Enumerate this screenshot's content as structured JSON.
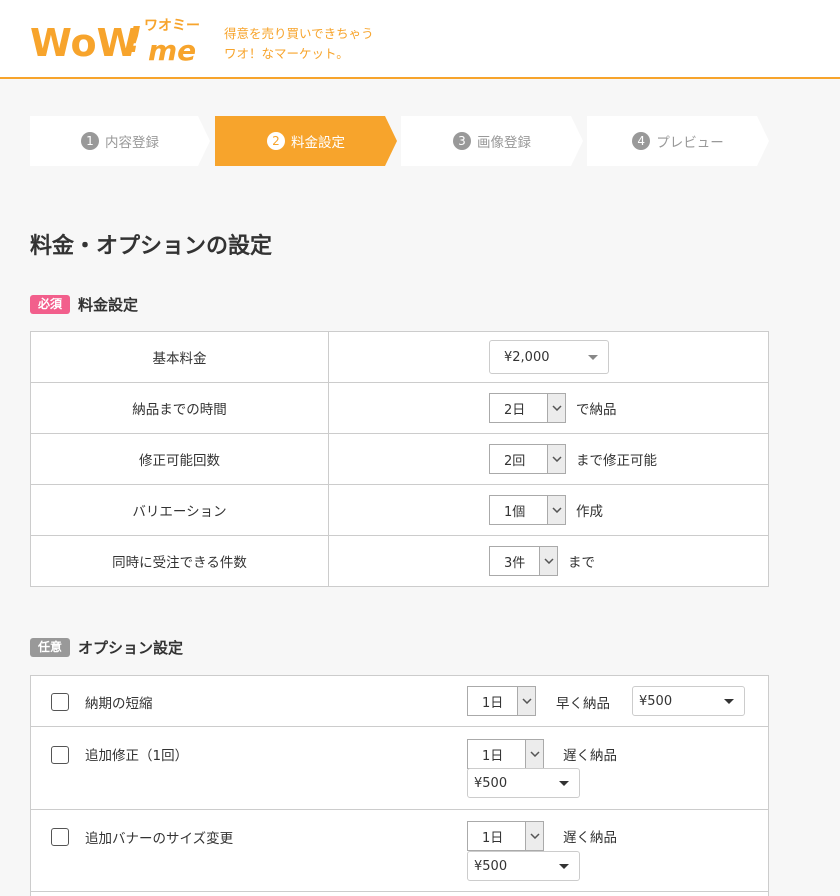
{
  "brand": {
    "logo_text": "WoW!me",
    "logo_kana": "ワオミー",
    "tagline_line1": "得意を売り買いできちゃう",
    "tagline_line2": "ワオ！なマーケット。",
    "accent_color": "#f7a42c"
  },
  "steps": [
    {
      "num": "1",
      "label": "内容登録",
      "active": false
    },
    {
      "num": "2",
      "label": "料金設定",
      "active": true
    },
    {
      "num": "3",
      "label": "画像登録",
      "active": false
    },
    {
      "num": "4",
      "label": "プレビュー",
      "active": false
    }
  ],
  "page_title": "料金・オプションの設定",
  "pricing": {
    "badge": "必須",
    "heading": "料金設定",
    "rows": [
      {
        "label": "基本料金",
        "value": "¥2,000",
        "suffix": ""
      },
      {
        "label": "納品までの時間",
        "value": "2日",
        "suffix": "で納品"
      },
      {
        "label": "修正可能回数",
        "value": "2回",
        "suffix": "まで修正可能"
      },
      {
        "label": "バリエーション",
        "value": "1個",
        "suffix": "作成"
      },
      {
        "label": "同時に受注できる件数",
        "value": "3件",
        "suffix": "まで"
      }
    ]
  },
  "options": {
    "badge": "任意",
    "heading": "オプション設定",
    "rows": [
      {
        "label": "納期の短縮",
        "days": "1日",
        "text": "早く納品",
        "price": "¥500",
        "checked": false
      },
      {
        "label": "追加修正（1回）",
        "days": "1日",
        "text": "遅く納品",
        "price": "¥500",
        "checked": false
      },
      {
        "label": "追加バナーのサイズ変更",
        "days": "1日",
        "text": "遅く納品",
        "price": "¥500",
        "checked": false
      }
    ]
  }
}
